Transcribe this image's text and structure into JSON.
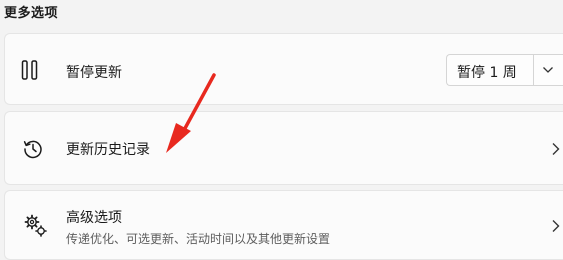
{
  "section": {
    "title": "更多选项"
  },
  "pause": {
    "label": "暂停更新",
    "selected": "暂停 1 周",
    "icon": "pause-icon",
    "dropdown_icon": "chevron-down-icon"
  },
  "history": {
    "label": "更新历史记录",
    "icon": "history-icon"
  },
  "advanced": {
    "label": "高级选项",
    "sublabel": "传递优化、可选更新、活动时间以及其他更新设置",
    "icon": "gears-icon"
  },
  "annotation": {
    "color": "#e8291f"
  }
}
